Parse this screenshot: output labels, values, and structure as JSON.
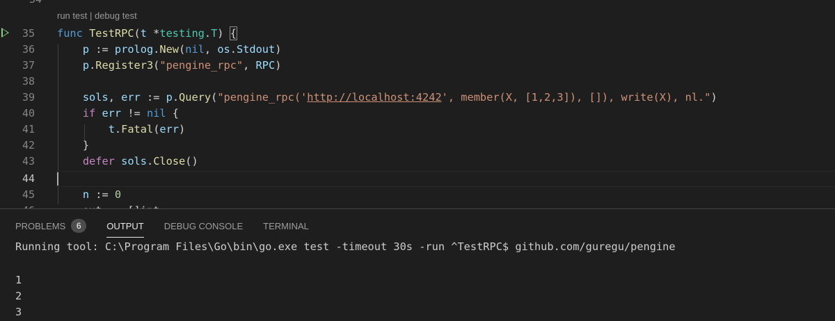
{
  "codelens": {
    "run": "run test",
    "sep": " | ",
    "debug": "debug test"
  },
  "line_numbers": {
    "prev": "34",
    "l35": "35",
    "l36": "36",
    "l37": "37",
    "l38": "38",
    "l39": "39",
    "l40": "40",
    "l41": "41",
    "l42": "42",
    "l43": "43",
    "l44": "44",
    "l45": "45",
    "l46": "46"
  },
  "code": {
    "l35": {
      "func": "func",
      "name": "TestRPC",
      "open": "(",
      "param": "t",
      "star": " *",
      "pkg": "testing",
      "dot": ".",
      "type": "T",
      "close": ") ",
      "brace": "{"
    },
    "l36": {
      "var": "p",
      "op": " := ",
      "pkg": "prolog",
      "dot": ".",
      "fn": "New",
      "open": "(",
      "nil": "nil",
      "comma": ", ",
      "pkg2": "os",
      "dot2": ".",
      "field": "Stdout",
      "close": ")"
    },
    "l37": {
      "var": "p",
      "dot": ".",
      "fn": "Register3",
      "open": "(",
      "str": "\"pengine_rpc\"",
      "comma": ", ",
      "arg": "RPC",
      "close": ")"
    },
    "l39": {
      "v1": "sols",
      "comma": ", ",
      "v2": "err",
      "op": " := ",
      "var": "p",
      "dot": ".",
      "fn": "Query",
      "open": "(",
      "str_a": "\"pengine_rpc('",
      "url": "http://localhost:4242",
      "str_b": "', member(X, [1,2,3]), []), write(X), nl.\"",
      "close": ")"
    },
    "l40": {
      "if": "if",
      "var": " err",
      "op": " != ",
      "nil": "nil",
      "brace": " {"
    },
    "l41": {
      "var": "t",
      "dot": ".",
      "fn": "Fatal",
      "open": "(",
      "arg": "err",
      "close": ")"
    },
    "l42": {
      "brace": "}"
    },
    "l43": {
      "defer": "defer",
      "var": " sols",
      "dot": ".",
      "fn": "Close",
      "parens": "()"
    },
    "l45": {
      "var": "n",
      "op": " := ",
      "num": "0"
    },
    "l46": {
      "text": "    out := []int"
    }
  },
  "panel": {
    "tabs": {
      "problems": "PROBLEMS",
      "problems_count": "6",
      "output": "OUTPUT",
      "debug_console": "DEBUG CONSOLE",
      "terminal": "TERMINAL"
    },
    "output_lines": {
      "cmd": "Running tool: C:\\Program Files\\Go\\bin\\go.exe test -timeout 30s -run ^TestRPC$ github.com/guregu/pengine",
      "o1": "1",
      "o2": "2",
      "o3": "3"
    }
  },
  "colors": {
    "run_icon": "#89d185",
    "editor_bg": "#1e1e1e"
  },
  "icons": {
    "run": "play-triangle-icon"
  }
}
